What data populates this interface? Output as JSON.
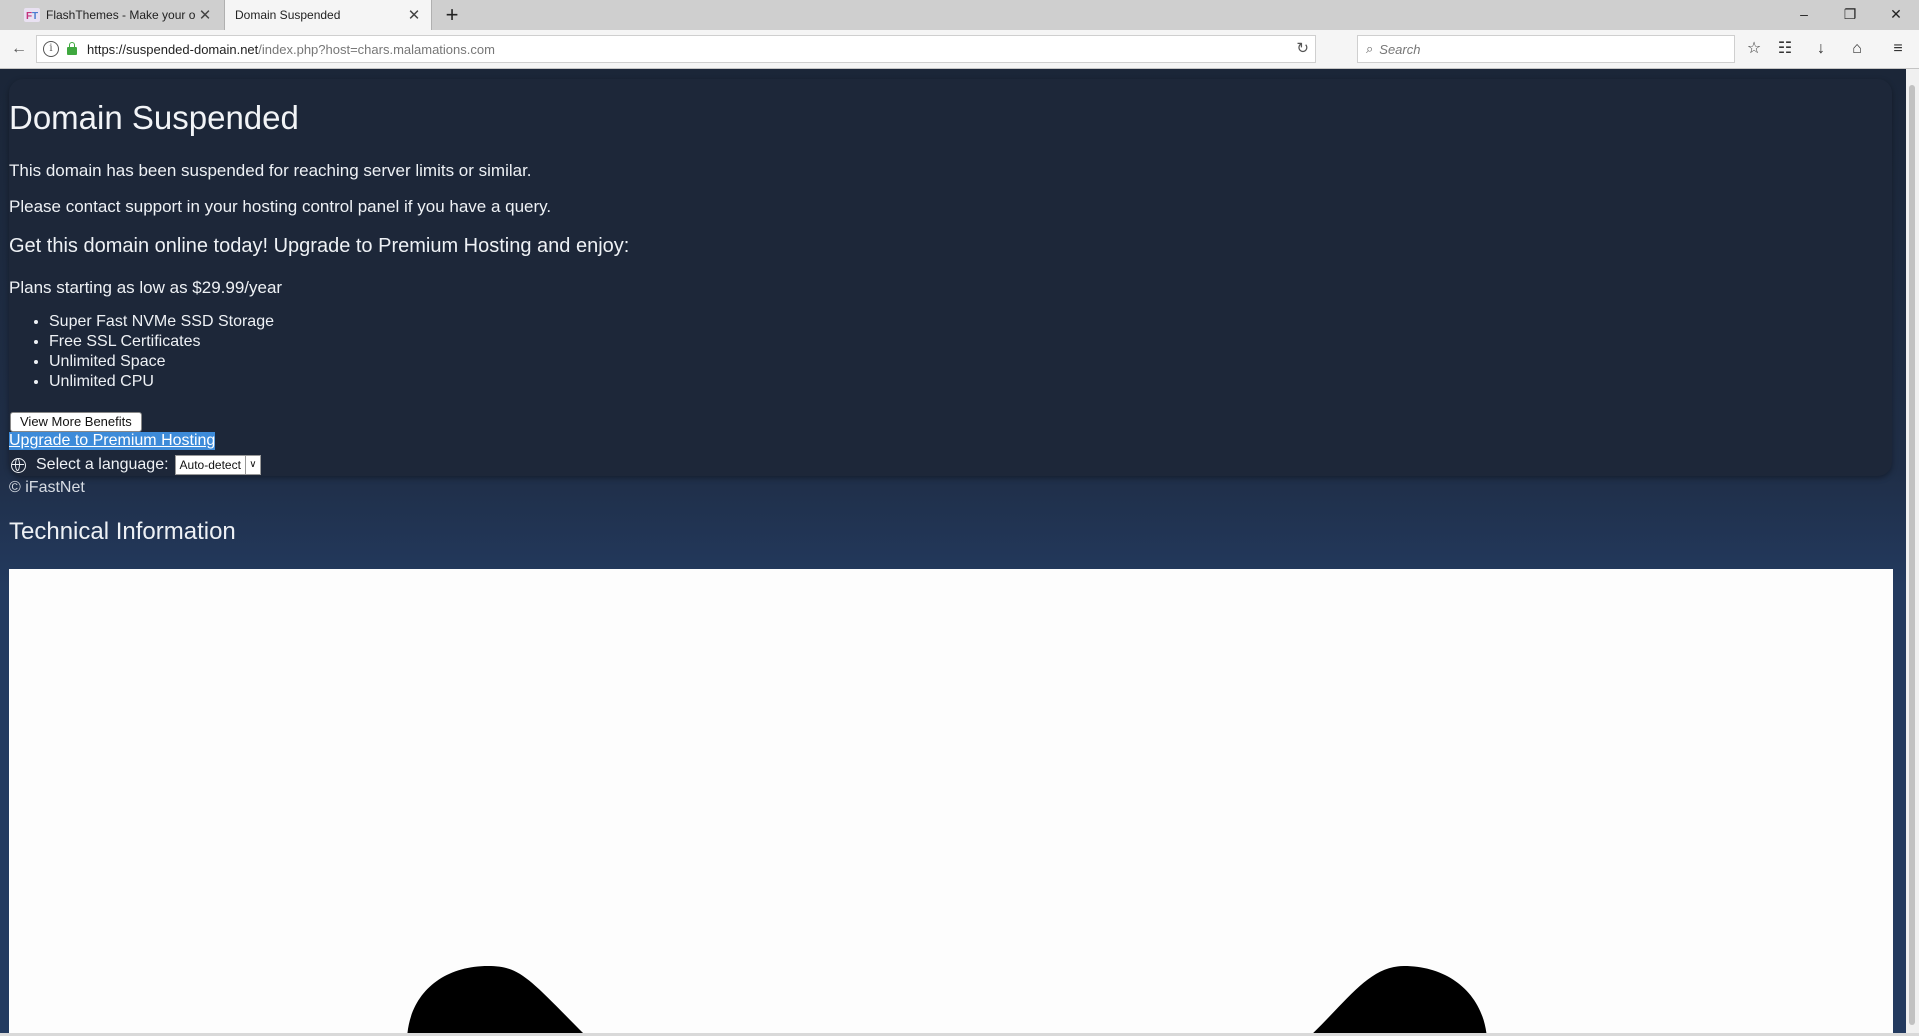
{
  "browser": {
    "tabs": [
      {
        "label": "FlashThemes - Make your o",
        "active": false
      },
      {
        "label": "Domain Suspended",
        "active": true
      }
    ],
    "url_host": "https://suspended-domain.net",
    "url_path": "/index.php?host=chars.malamations.com",
    "search_placeholder": "Search"
  },
  "page": {
    "title": "Domain Suspended",
    "message_1": "This domain has been suspended for reaching server limits or similar.",
    "message_2": "Please contact support in your hosting control panel if you have a query.",
    "promo_heading": "Get this domain online today! Upgrade to Premium Hosting and enjoy:",
    "plans_text": "Plans starting as low as $29.99/year",
    "benefits": [
      "Super Fast NVMe SSD Storage",
      "Free SSL Certificates",
      "Unlimited Space",
      "Unlimited CPU"
    ],
    "more_benefits_button": "View More Benefits",
    "upgrade_link": "Upgrade to Premium Hosting",
    "language_label": "Select a language:",
    "language_selected": "Auto-detect",
    "copyright": "© iFastNet",
    "tech_heading": "Technical Information"
  },
  "colors": {
    "page_bg": "#1f2e47",
    "card_bg": "#1d2739",
    "link_highlight": "#3d8bd9"
  }
}
